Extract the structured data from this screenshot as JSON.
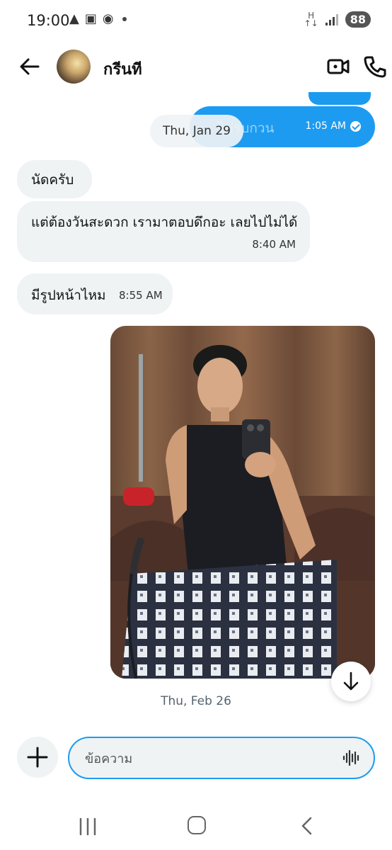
{
  "status_bar": {
    "time": "19:00",
    "battery": "88",
    "network": "H"
  },
  "header": {
    "contact_name": "กรีนที",
    "icons": [
      "back-arrow-icon",
      "video-camera-icon",
      "phone-icon"
    ]
  },
  "messages": {
    "outgoing_partial_text": "ไม่รบกวน",
    "outgoing_time": "1:05 AM",
    "date_divider_1": "Thu, Jan 29",
    "incoming": [
      {
        "text": "นัดครับ",
        "time": ""
      },
      {
        "text": "แต่ต้องวันสะดวก เรามาตอบดึกอะ เลยไปไม่ได้",
        "time": "8:40 AM"
      },
      {
        "text": "มีรูปหน้าไหม",
        "time": "8:55 AM"
      }
    ],
    "date_divider_2": "Thu, Feb 26"
  },
  "composer": {
    "placeholder": "ข้อความ"
  },
  "colors": {
    "accent": "#1d9bf0",
    "incoming_bubble": "#eff3f4"
  }
}
